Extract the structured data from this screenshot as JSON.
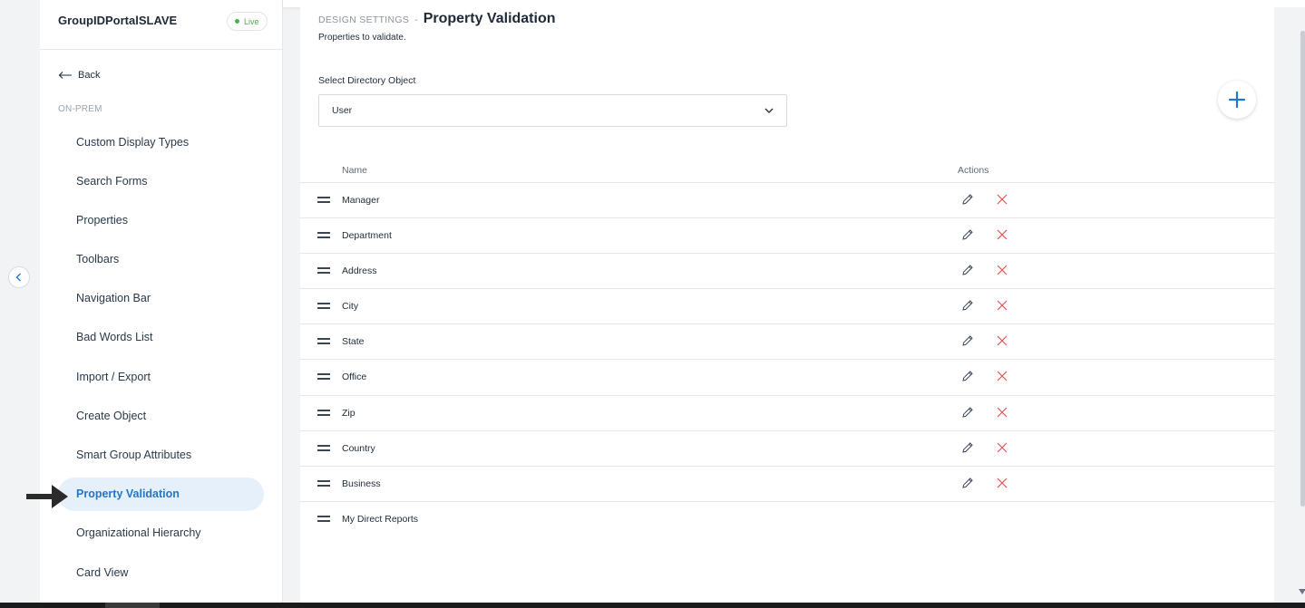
{
  "sidebar": {
    "portal_name": "GroupIDPortalSLAVE",
    "status_badge": "Live",
    "back_label": "Back",
    "section_label": "ON-PREM",
    "items": [
      {
        "label": "Custom Display Types",
        "active": false
      },
      {
        "label": "Search Forms",
        "active": false
      },
      {
        "label": "Properties",
        "active": false
      },
      {
        "label": "Toolbars",
        "active": false
      },
      {
        "label": "Navigation Bar",
        "active": false
      },
      {
        "label": "Bad Words List",
        "active": false
      },
      {
        "label": "Import / Export",
        "active": false
      },
      {
        "label": "Create Object",
        "active": false
      },
      {
        "label": "Smart Group Attributes",
        "active": false
      },
      {
        "label": "Property Validation",
        "active": true
      },
      {
        "label": "Organizational Hierarchy",
        "active": false
      },
      {
        "label": "Card View",
        "active": false
      }
    ]
  },
  "header": {
    "breadcrumb_parent": "DESIGN SETTINGS",
    "breadcrumb_separator": "-",
    "title": "Property Validation",
    "subtitle": "Properties to validate."
  },
  "form": {
    "select_label": "Select Directory Object",
    "select_value": "User"
  },
  "table": {
    "col_name": "Name",
    "col_actions": "Actions",
    "rows": [
      {
        "name": "Manager",
        "has_actions": true
      },
      {
        "name": "Department",
        "has_actions": true
      },
      {
        "name": "Address",
        "has_actions": true
      },
      {
        "name": "City",
        "has_actions": true
      },
      {
        "name": "State",
        "has_actions": true
      },
      {
        "name": "Office",
        "has_actions": true
      },
      {
        "name": "Zip",
        "has_actions": true
      },
      {
        "name": "Country",
        "has_actions": true
      },
      {
        "name": "Business",
        "has_actions": true
      },
      {
        "name": "My Direct Reports",
        "has_actions": false
      }
    ]
  },
  "colors": {
    "accent": "#2476c7",
    "active_bg": "#e6f0fa",
    "live_green": "#4caf50",
    "delete_red": "#e05252"
  },
  "icons": {
    "collapse": "chevron-left-icon",
    "back": "arrow-left-icon",
    "add": "plus-icon",
    "edit": "pencil-icon",
    "delete": "close-icon",
    "drag": "drag-handle-icon",
    "dropdown": "chevron-down-icon",
    "pointer": "arrow-right-icon"
  }
}
